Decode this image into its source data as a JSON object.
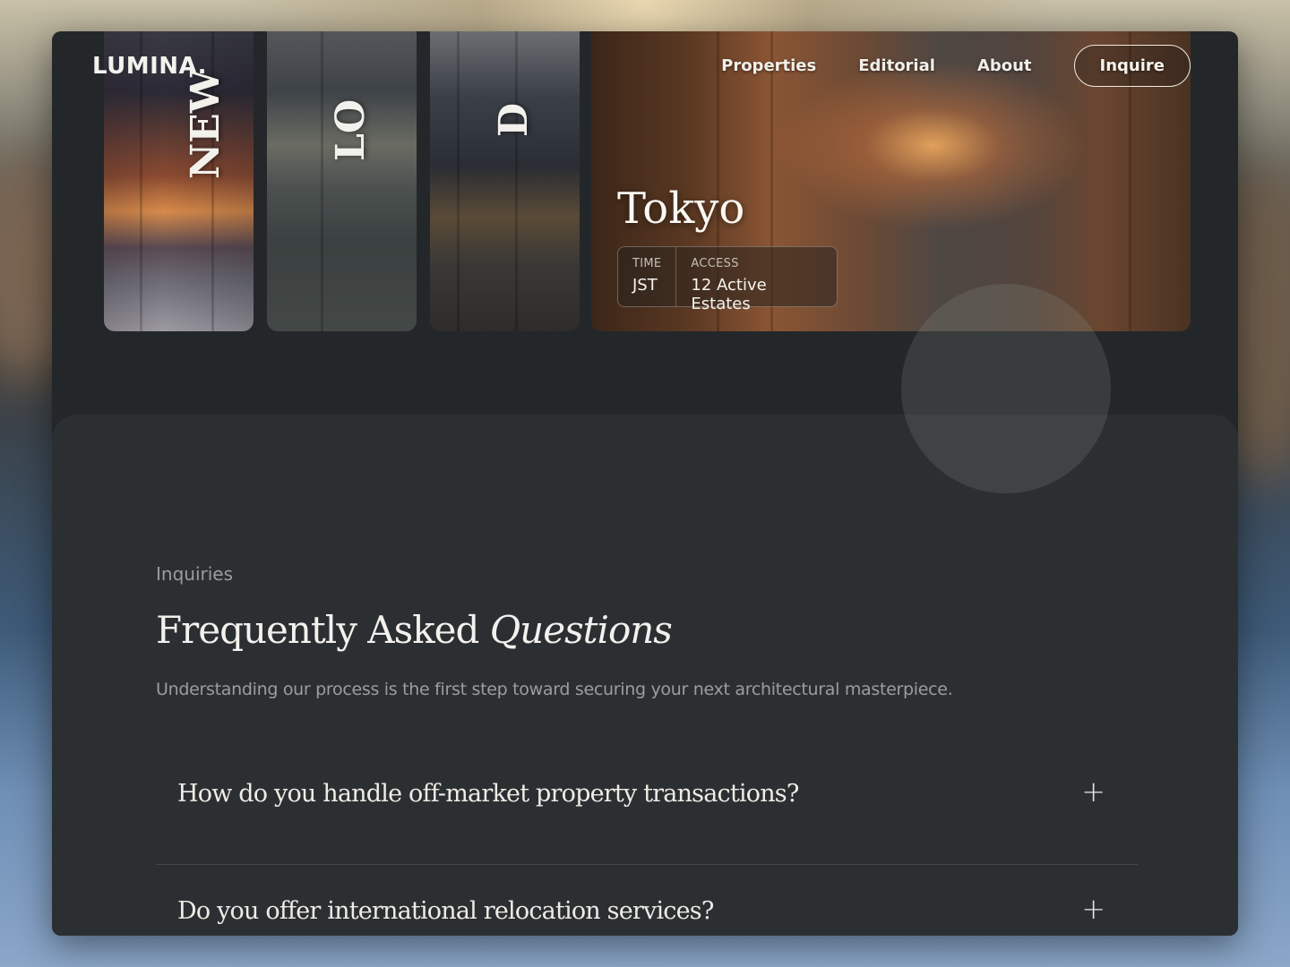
{
  "brand": {
    "logo": "LUMINA."
  },
  "nav": {
    "items": [
      "Properties",
      "Editorial",
      "About"
    ],
    "cta_label": "Inquire"
  },
  "cities": [
    {
      "name": "NEW"
    },
    {
      "name": "LO"
    },
    {
      "name": "D"
    }
  ],
  "featured": {
    "title": "Tokyo",
    "time_label": "TIME",
    "time_value": "JST",
    "access_label": "ACCESS",
    "access_value": "12 Active Estates"
  },
  "faq": {
    "eyebrow": "Inquiries",
    "title_main": "Frequently Asked",
    "title_emphasis": "Questions",
    "subtitle": "Understanding our process is the first step toward securing your next architectural masterpiece.",
    "items": [
      {
        "question": "How do you handle off-market property transactions?",
        "toggle": "+"
      },
      {
        "question": "Do you offer international relocation services?",
        "toggle": "+"
      }
    ]
  },
  "colors": {
    "panel": "#24272a",
    "faq_panel": "#2c2f32",
    "text_primary": "#f3f1ed",
    "text_muted": "#9b9da0"
  }
}
